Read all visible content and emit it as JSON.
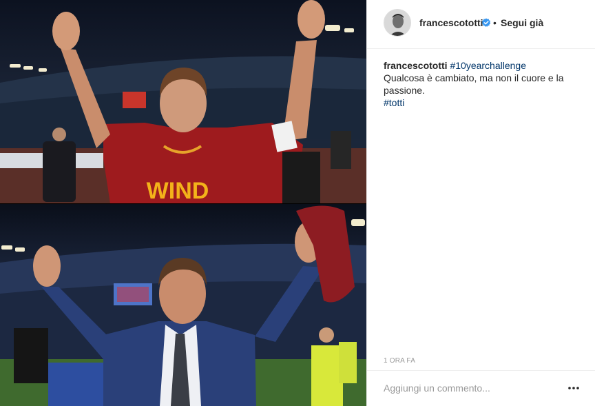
{
  "post": {
    "photo_top_alt": "",
    "photo_bottom_alt": "",
    "jersey_text": "WIND"
  },
  "header": {
    "username": "francescototti",
    "verified_icon": "verified-badge-icon",
    "separator": "•",
    "follow_label": "Segui già"
  },
  "caption": {
    "username": "francescototti",
    "hashtag_challenge": "#10yearchallenge",
    "text": "Qualcosa è cambiato, ma non il cuore e la passione.",
    "hashtag_name": "#totti"
  },
  "timestamp": "1 ORA FA",
  "comment": {
    "placeholder": "Aggiungi un commento...",
    "more_icon": "more-options-icon"
  },
  "colors": {
    "link": "#003569",
    "verified": "#3897f0",
    "muted": "#999999",
    "text": "#262626"
  }
}
